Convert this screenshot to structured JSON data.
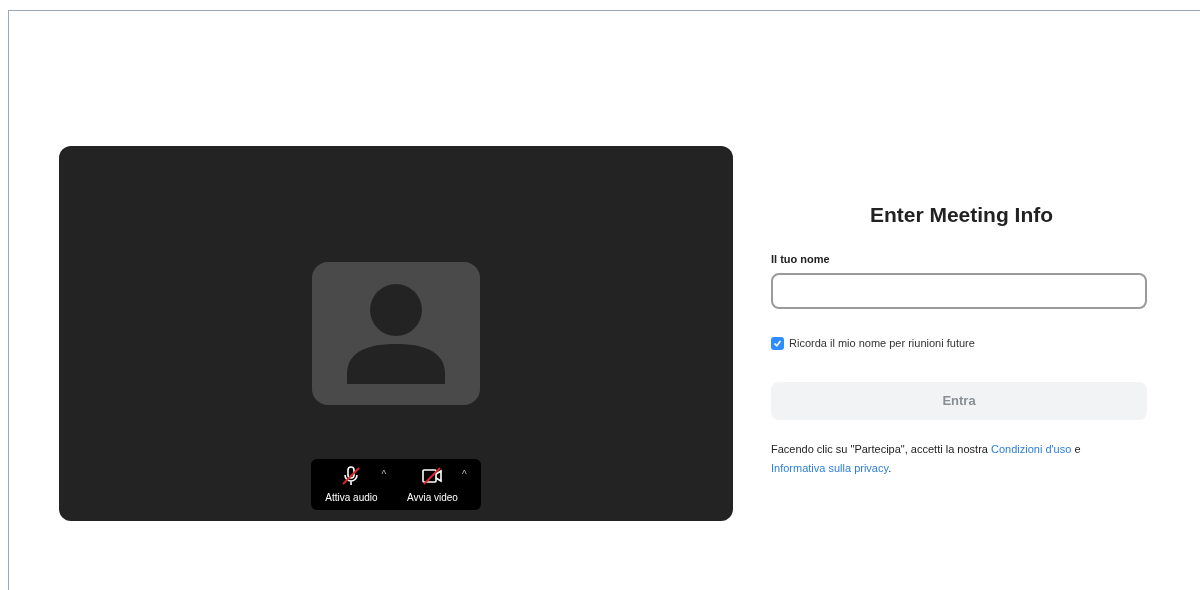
{
  "preview": {
    "controls": [
      {
        "kind": "audio",
        "label": "Attiva audio",
        "caret": "^",
        "muted": true
      },
      {
        "kind": "video",
        "label": "Avvia video",
        "caret": "^",
        "muted": true
      }
    ]
  },
  "form": {
    "title": "Enter Meeting Info",
    "name_label": "Il tuo nome",
    "remember": {
      "label": "Ricorda il mio nome per riunioni future",
      "checked": true
    },
    "join_button": {
      "label": "Entra",
      "disabled": true
    },
    "consent": {
      "text_before": "Facendo clic su \"Partecipa\", accetti la nostra ",
      "terms_link": "Condizioni d'uso",
      "text_mid": " e ",
      "privacy_link": "Informativa sulla privacy",
      "text_end": "."
    }
  }
}
